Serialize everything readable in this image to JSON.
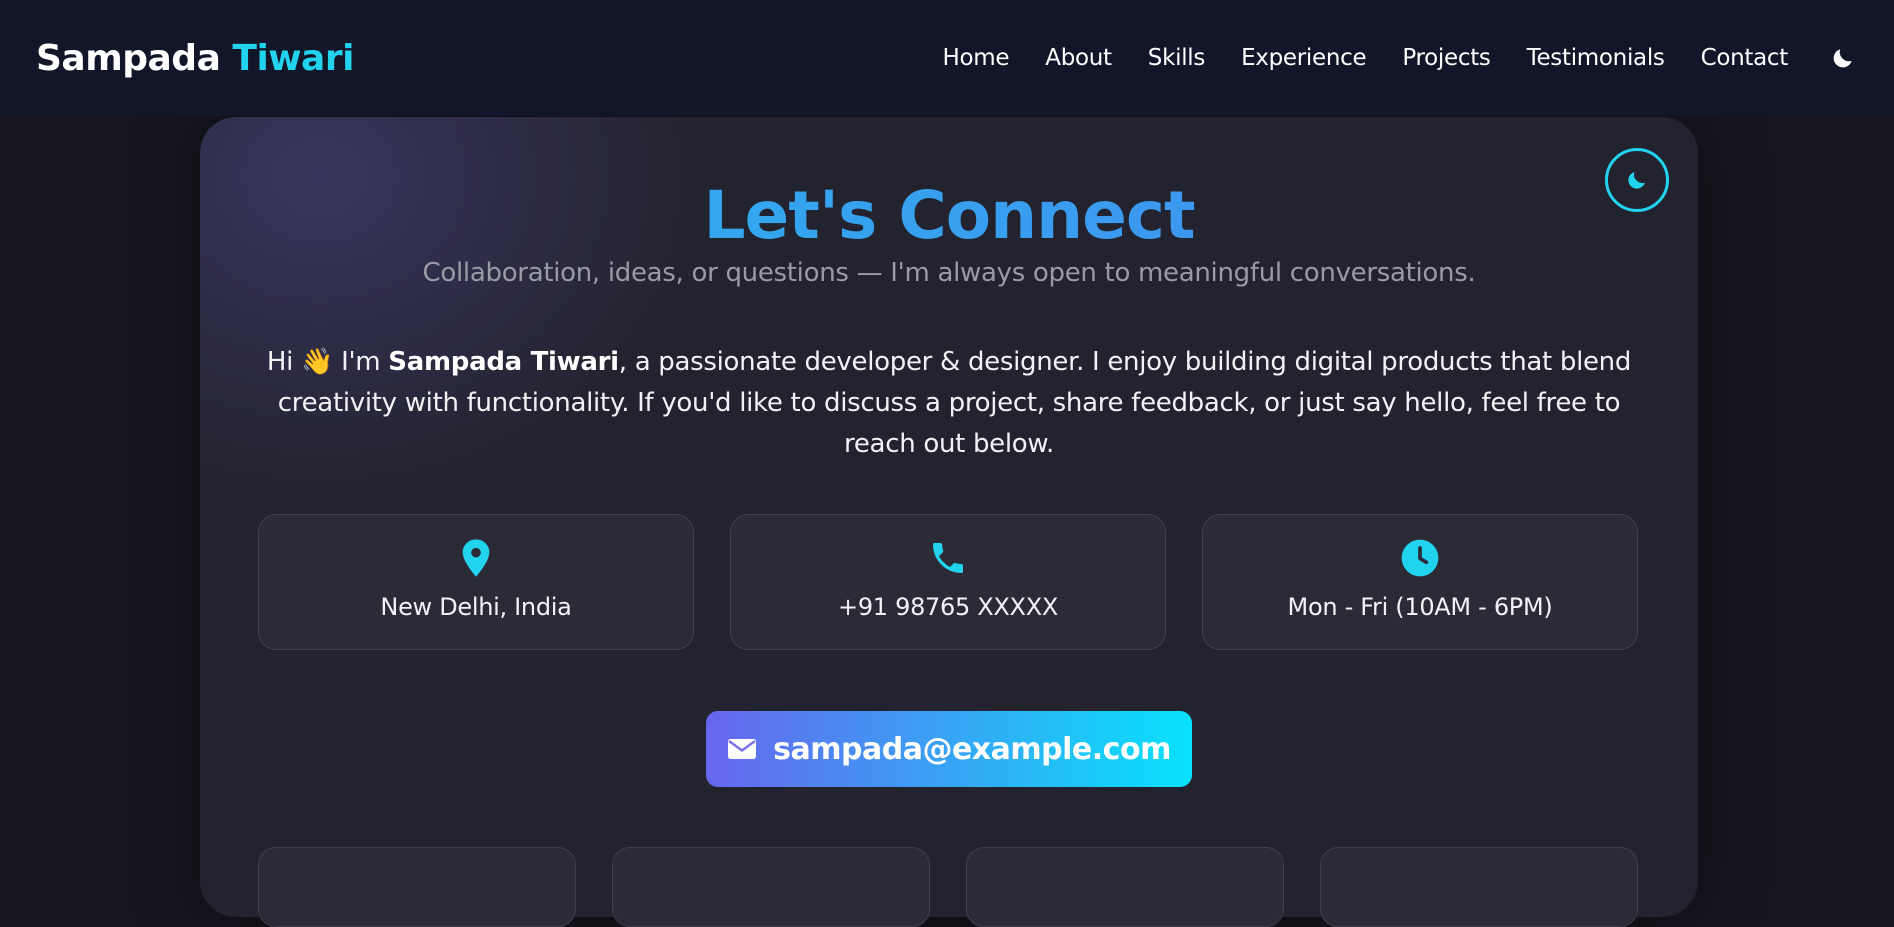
{
  "nav": {
    "brand_first": "Sampada",
    "brand_second": "Tiwari",
    "links": [
      "Home",
      "About",
      "Skills",
      "Experience",
      "Projects",
      "Testimonials",
      "Contact"
    ]
  },
  "contact": {
    "title": "Let's Connect",
    "subtitle": "Collaboration, ideas, or questions — I'm always open to meaningful conversations.",
    "intro_pre": "Hi 👋 I'm ",
    "intro_name": "Sampada Tiwari",
    "intro_post": ", a passionate developer & designer. I enjoy building digital products that blend creativity with functionality. If you'd like to discuss a project, share feedback, or just say hello, feel free to reach out below.",
    "info": [
      {
        "icon": "map-pin-icon",
        "text": "New Delhi, India"
      },
      {
        "icon": "phone-icon",
        "text": "+91 98765 XXXXX"
      },
      {
        "icon": "clock-icon",
        "text": "Mon - Fri (10AM - 6PM)"
      }
    ],
    "email": "sampada@example.com"
  },
  "colors": {
    "accent": "#22d3ee",
    "title_gradient_start": "#2bb6f0",
    "title_gradient_end": "#4489ee",
    "button_gradient_start": "#6766ee",
    "button_gradient_end": "#08e2fa",
    "navbar_bg": "#111629",
    "card_bg": "#23232f"
  }
}
